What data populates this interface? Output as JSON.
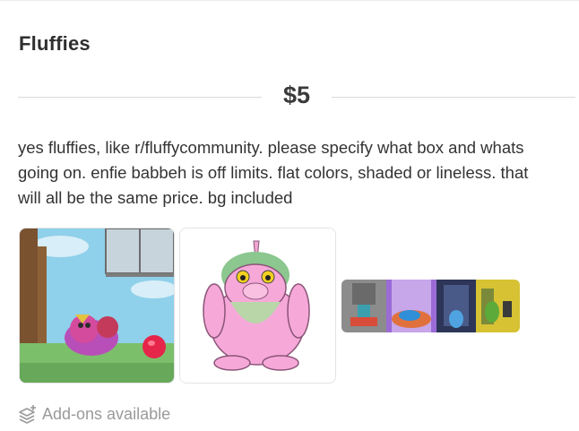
{
  "listing": {
    "title": "Fluffies",
    "price": "$5",
    "description": "yes fluffies, like r/fluffycommunity. please specify what box and whats going on. enfie babbeh is off limits. flat colors, shaded or lineless. that will all be the same price. bg included"
  },
  "gallery": {
    "images": [
      {
        "icon": "fluffy-scene-image"
      },
      {
        "icon": "pink-fluffy-image"
      },
      {
        "icon": "box-strip-image"
      }
    ]
  },
  "addons": {
    "label": "Add-ons available",
    "icon": "layers-plus-icon"
  },
  "colors": {
    "text": "#333333",
    "muted": "#9a9a9a",
    "divider": "#d9d9d9"
  }
}
